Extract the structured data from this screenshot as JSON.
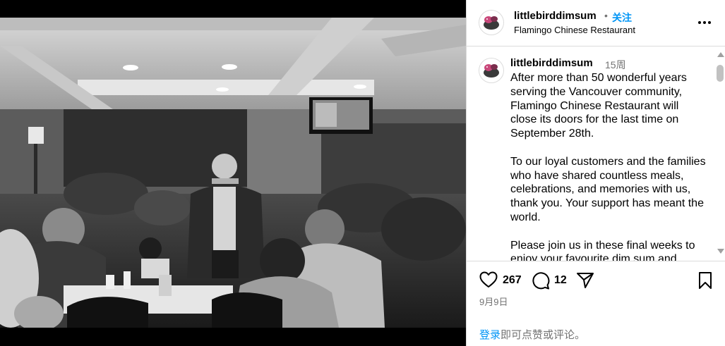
{
  "post": {
    "username": "littlebirddimsum",
    "dot": "•",
    "follow_label": "关注",
    "location": "Flamingo Chinese Restaurant",
    "more_icon": "more-horizontal-icon"
  },
  "caption": {
    "username": "littlebirddimsum",
    "time_ago": "15周",
    "paragraphs": [
      "After more than 50 wonderful years serving the Vancouver community, Flamingo Chinese Restaurant will close its doors for the last time on September 28th.",
      "To our loyal customers and the families who have shared countless meals, celebrations, and memories with us, thank you. Your support has meant the world.",
      "Please join us in these final weeks to enjoy your favourite dim sum and"
    ]
  },
  "actions": {
    "like_icon": "heart-icon",
    "like_count": "267",
    "comment_icon": "comment-bubble-icon",
    "comment_count": "12",
    "share_icon": "paper-plane-icon",
    "save_icon": "bookmark-icon",
    "date": "9月9日"
  },
  "login": {
    "link_text": "登录",
    "rest_text": "即可点赞或评论。"
  },
  "colors": {
    "accent": "#0095f6",
    "muted": "#737373",
    "divider": "#dbdbdb"
  }
}
